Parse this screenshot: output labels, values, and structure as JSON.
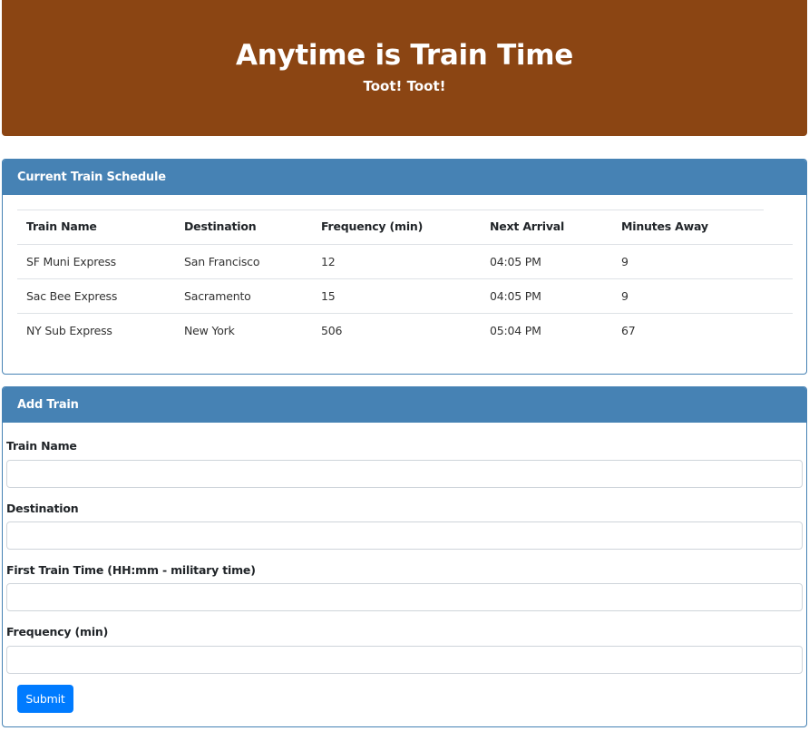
{
  "header": {
    "title": "Anytime is Train Time",
    "subtitle": "Toot! Toot!"
  },
  "schedule": {
    "title": "Current Train Schedule",
    "columns": [
      "Train Name",
      "Destination",
      "Frequency (min)",
      "Next Arrival",
      "Minutes Away"
    ],
    "rows": [
      [
        "SF Muni Express",
        "San Francisco",
        "12",
        "04:05 PM",
        "9"
      ],
      [
        "Sac Bee Express",
        "Sacramento",
        "15",
        "04:05 PM",
        "9"
      ],
      [
        "NY Sub Express",
        "New York",
        "506",
        "05:04 PM",
        "67"
      ]
    ]
  },
  "form": {
    "title": "Add Train",
    "train_name_label": "Train Name",
    "destination_label": "Destination",
    "first_time_label": "First Train Time (HH:mm - military time)",
    "frequency_label": "Frequency (min)",
    "train_name_value": "",
    "destination_value": "",
    "first_time_value": "",
    "frequency_value": "",
    "submit_label": "Submit"
  },
  "colors": {
    "jumbotron_bg": "#8b4513",
    "card_header_bg": "#4682b4",
    "submit_bg": "#007bff"
  }
}
